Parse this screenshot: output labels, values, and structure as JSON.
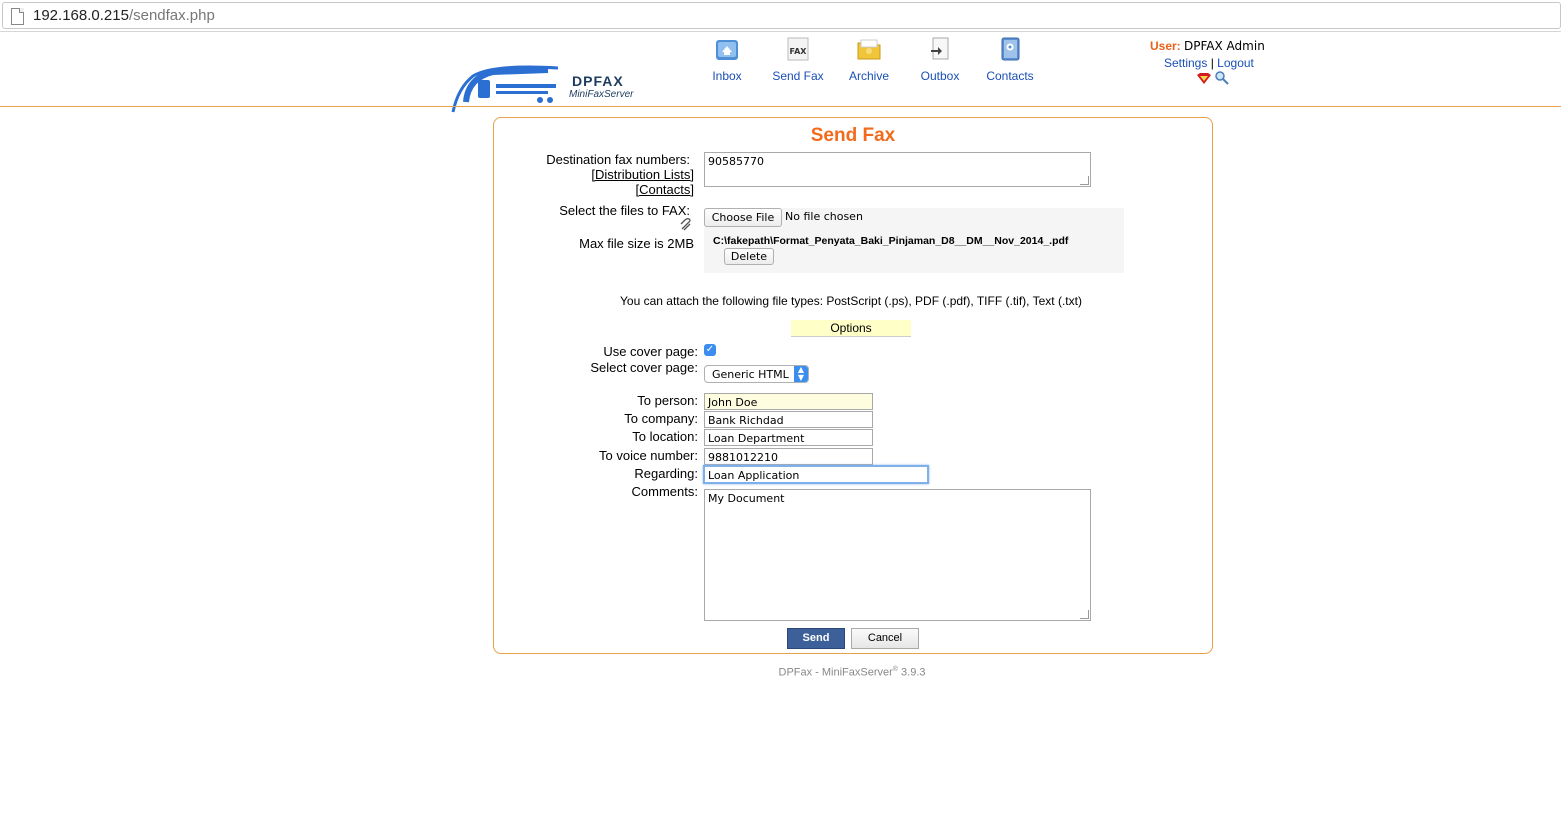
{
  "browser": {
    "url_host": "192.168.0.215",
    "url_path": "/sendfax.php"
  },
  "logo": {
    "name": "DPFAX",
    "subtitle": "MiniFaxServer"
  },
  "nav": {
    "items": [
      {
        "label": "Inbox",
        "icon": "inbox-icon"
      },
      {
        "label": "Send Fax",
        "icon": "fax-icon"
      },
      {
        "label": "Archive",
        "icon": "archive-folder-icon"
      },
      {
        "label": "Outbox",
        "icon": "outbox-icon"
      },
      {
        "label": "Contacts",
        "icon": "contacts-book-icon"
      }
    ],
    "fax_icon_text": "FAX"
  },
  "user": {
    "label": "User:",
    "name": "DPFAX Admin",
    "settings": "Settings",
    "separator": "|",
    "logout": "Logout"
  },
  "form": {
    "title": "Send Fax",
    "dest_label": "Destination fax numbers:",
    "dist_lists": "[Distribution Lists]",
    "contacts_link": "[Contacts]",
    "dest_value": "90585770",
    "files_label": "Select the files to FAX:",
    "max_size": "Max file size is 2MB",
    "choose_file": "Choose File",
    "no_file": "No file chosen",
    "attached_file": "C:\\fakepath\\Format_Penyata_Baki_Pinjaman_D8__DM__Nov_2014_.pdf",
    "delete": "Delete",
    "file_types": "You can attach the following file types: PostScript (.ps), PDF (.pdf), TIFF (.tif), Text (.txt)",
    "options": "Options",
    "use_cover_label": "Use cover page:",
    "use_cover_checked": true,
    "select_cover_label": "Select cover page:",
    "cover_selected": "Generic HTML",
    "to_person_label": "To person:",
    "to_person": "John Doe",
    "to_company_label": "To company:",
    "to_company": "Bank Richdad",
    "to_location_label": "To location:",
    "to_location": "Loan Department",
    "to_voice_label": "To voice number:",
    "to_voice": "9881012210",
    "regarding_label": "Regarding:",
    "regarding": "Loan Application",
    "comments_label": "Comments:",
    "comments": "My Document",
    "send": "Send",
    "cancel": "Cancel"
  },
  "footer": {
    "product": "DPFax - MiniFaxServer",
    "reg": "®",
    "version": " 3.9.3"
  },
  "colors": {
    "accent_orange": "#e8a04a",
    "title_orange": "#f26a1b",
    "link_blue": "#1a4fb5",
    "send_button": "#3d5f9a"
  }
}
